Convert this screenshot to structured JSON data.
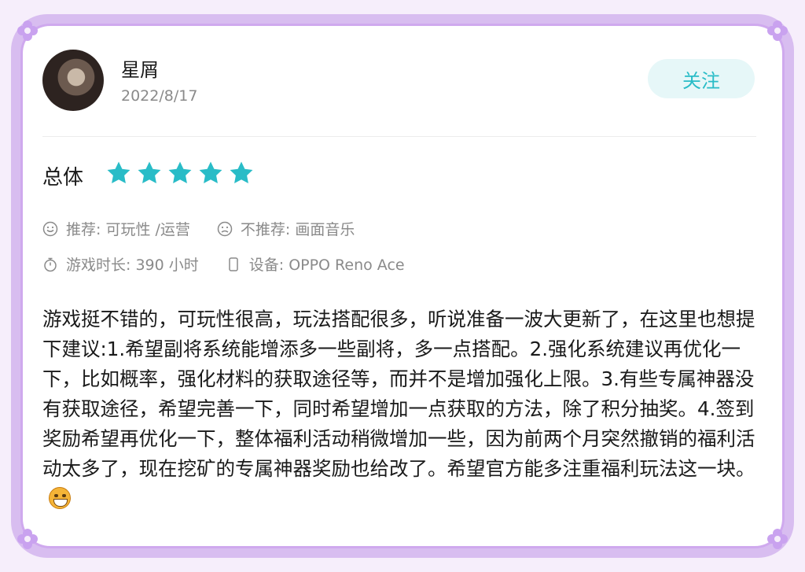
{
  "user": {
    "name": "星屑",
    "date": "2022/8/17",
    "follow_label": "关注"
  },
  "rating": {
    "label": "总体",
    "stars": 5,
    "max_stars": 5,
    "star_color": "#29bcc7"
  },
  "meta": {
    "recommend": "推荐: 可玩性 /运营",
    "not_recommend": "不推荐: 画面音乐",
    "play_time": "游戏时长:  390 小时",
    "device": "设备:  OPPO Reno Ace"
  },
  "review": {
    "text": "游戏挺不错的，可玩性很高，玩法搭配很多，听说准备一波大更新了，在这里也想提下建议:1.希望副将系统能增添多一些副将，多一点搭配。2.强化系统建议再优化一下，比如概率，强化材料的获取途径等，而并不是增加强化上限。3.有些专属神器没有获取途径，希望完善一下，同时希望增加一点获取的方法，除了积分抽奖。4.签到奖励希望再优化一下，整体福利活动稍微增加一些，因为前两个月突然撤销的福利活动太多了，现在挖矿的专属神器奖励也给改了。希望官方能多注重福利玩法这一块。",
    "emoji": "grinning-face"
  },
  "colors": {
    "frame": "#d8bdf0",
    "accent": "#29bcc7",
    "follow_bg": "#e6f7f8"
  }
}
